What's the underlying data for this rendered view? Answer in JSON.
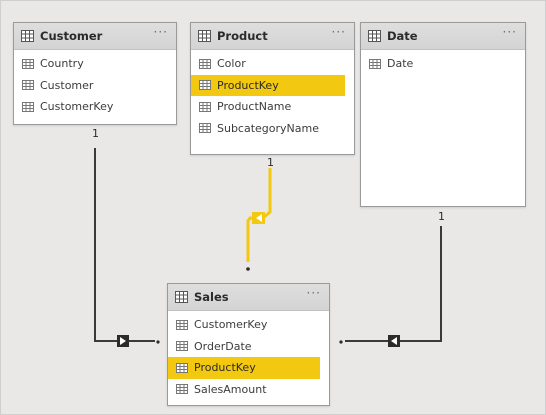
{
  "tables": {
    "customer": {
      "title": "Customer",
      "menu": "···",
      "fields": [
        "Country",
        "Customer",
        "CustomerKey"
      ]
    },
    "product": {
      "title": "Product",
      "menu": "···",
      "fields": [
        "Color",
        "ProductKey",
        "ProductName",
        "SubcategoryName"
      ],
      "selected_field": "ProductKey"
    },
    "date": {
      "title": "Date",
      "menu": "···",
      "fields": [
        "Date"
      ]
    },
    "sales": {
      "title": "Sales",
      "menu": "···",
      "fields": [
        "CustomerKey",
        "OrderDate",
        "ProductKey",
        "SalesAmount"
      ],
      "selected_field": "ProductKey"
    }
  },
  "relationships": [
    {
      "from": "Customer",
      "to": "Sales",
      "one_side_label": "1",
      "many_side_label": "*",
      "highlighted": false
    },
    {
      "from": "Product",
      "to": "Sales",
      "one_side_label": "1",
      "many_side_label": "*",
      "highlighted": true
    },
    {
      "from": "Date",
      "to": "Sales",
      "one_side_label": "1",
      "many_side_label": "*",
      "highlighted": false
    }
  ],
  "colors": {
    "highlight": "#f2c811",
    "line": "#3a3a3a",
    "canvas": "#e9e8e6"
  }
}
